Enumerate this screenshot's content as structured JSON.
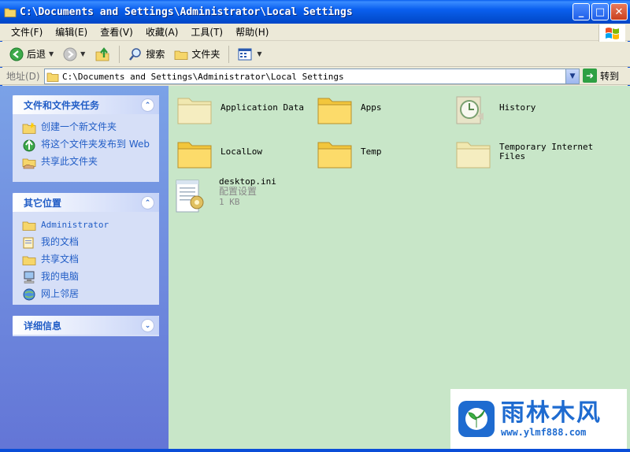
{
  "window": {
    "title": "C:\\Documents and Settings\\Administrator\\Local Settings",
    "minimize": "_",
    "maximize": "□",
    "close": "✕"
  },
  "menubar": [
    "文件(F)",
    "编辑(E)",
    "查看(V)",
    "收藏(A)",
    "工具(T)",
    "帮助(H)"
  ],
  "toolbar": {
    "back_label": "后退",
    "search_label": "搜索",
    "folders_label": "文件夹"
  },
  "address": {
    "label": "地址(D)",
    "value": "C:\\Documents and Settings\\Administrator\\Local Settings",
    "go_label": "转到"
  },
  "panels": {
    "tasks": {
      "title": "文件和文件夹任务",
      "items": [
        "创建一个新文件夹",
        "将这个文件夹发布到 Web",
        "共享此文件夹"
      ]
    },
    "places": {
      "title": "其它位置",
      "items": [
        "Administrator",
        "我的文档",
        "共享文档",
        "我的电脑",
        "网上邻居"
      ]
    },
    "details": {
      "title": "详细信息"
    }
  },
  "files": [
    {
      "name": "Application Data",
      "icon": "folder-icon"
    },
    {
      "name": "Apps",
      "icon": "folder-icon"
    },
    {
      "name": "History",
      "icon": "history-folder-icon"
    },
    {
      "name": "LocalLow",
      "icon": "folder-icon"
    },
    {
      "name": "Temp",
      "icon": "folder-icon"
    },
    {
      "name": "Temporary Internet Files",
      "icon": "folder-icon"
    },
    {
      "name": "desktop.ini",
      "type": "配置设置",
      "size": "1 KB",
      "icon": "config-file-icon"
    }
  ],
  "watermark": {
    "title": "雨林木风",
    "url": "www.ylmf888.com"
  },
  "colors": {
    "titlebar": "#0A5FEF",
    "leftpane": "#7BA2E7",
    "content_bg": "#C8E6C8",
    "link": "#215DC6"
  }
}
